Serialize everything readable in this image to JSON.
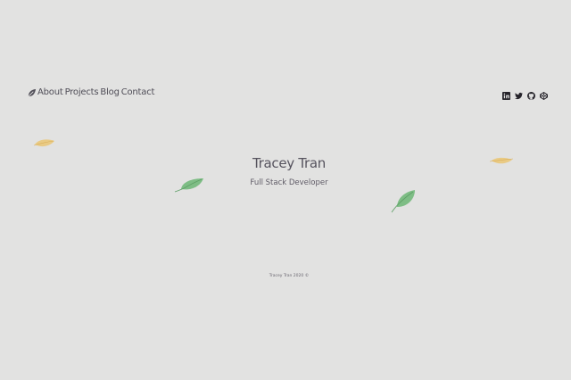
{
  "nav": {
    "logo_icon": "leaf-icon",
    "items": [
      {
        "label": "About"
      },
      {
        "label": "Projects"
      },
      {
        "label": "Blog"
      },
      {
        "label": "Contact"
      }
    ]
  },
  "social": [
    {
      "icon": "linkedin-icon"
    },
    {
      "icon": "twitter-icon"
    },
    {
      "icon": "github-icon"
    },
    {
      "icon": "codepen-icon"
    }
  ],
  "hero": {
    "name": "Tracey Tran",
    "role": "Full Stack Developer"
  },
  "footer": {
    "text": "Tracey Tran 2020 ©"
  },
  "colors": {
    "background": "#e2e2e1",
    "text": "#56535e",
    "leaf_green": "#7dbb82",
    "leaf_yellow": "#e9c46a"
  }
}
